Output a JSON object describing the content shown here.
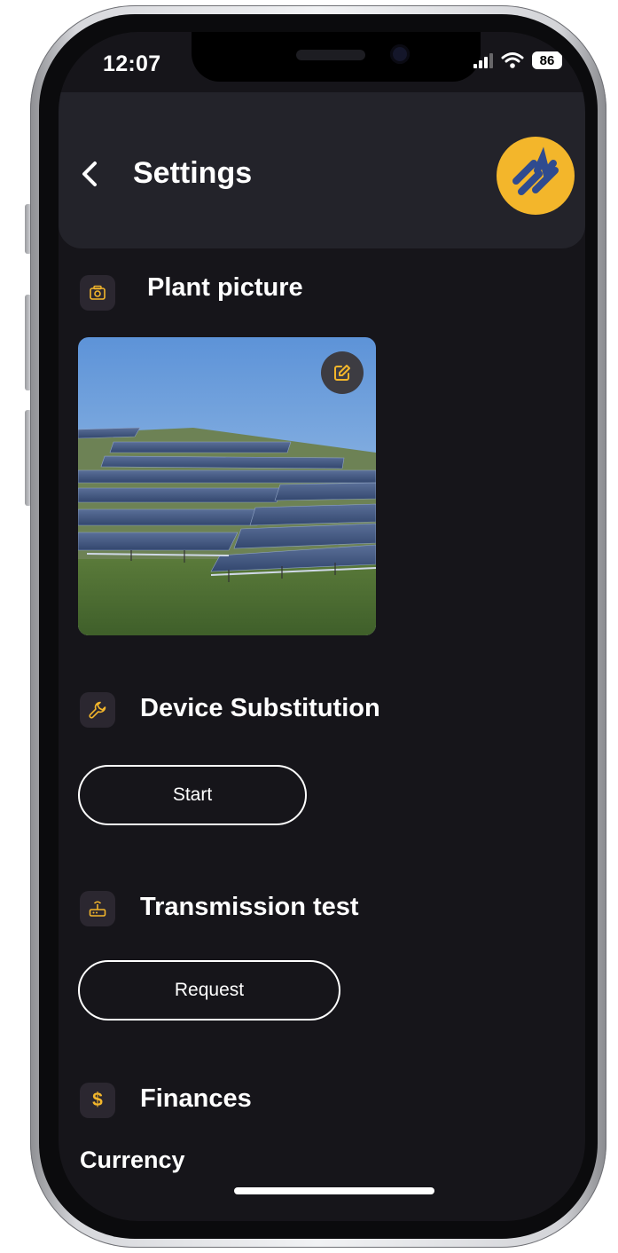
{
  "status_bar": {
    "time": "12:07",
    "battery": "86"
  },
  "header": {
    "title": "Settings"
  },
  "sections": {
    "plant_picture": {
      "title": "Plant picture"
    },
    "device_substitution": {
      "title": "Device Substitution",
      "button_label": "Start"
    },
    "transmission_test": {
      "title": "Transmission test",
      "button_label": "Request"
    },
    "finances": {
      "title": "Finances",
      "icon_text": "$",
      "currency_label": "Currency"
    }
  },
  "icons": {
    "back": "chevron-left-icon",
    "logo": "brand-logo",
    "camera": "camera-icon",
    "edit": "edit-icon",
    "wrench": "wrench-icon",
    "router": "router-icon",
    "dollar": "dollar-icon"
  },
  "colors": {
    "accent": "#f3b62b",
    "logo_mark": "#2f4b8f",
    "background": "#16151a",
    "header": "#23232a",
    "icon_tile": "#2b2730"
  }
}
